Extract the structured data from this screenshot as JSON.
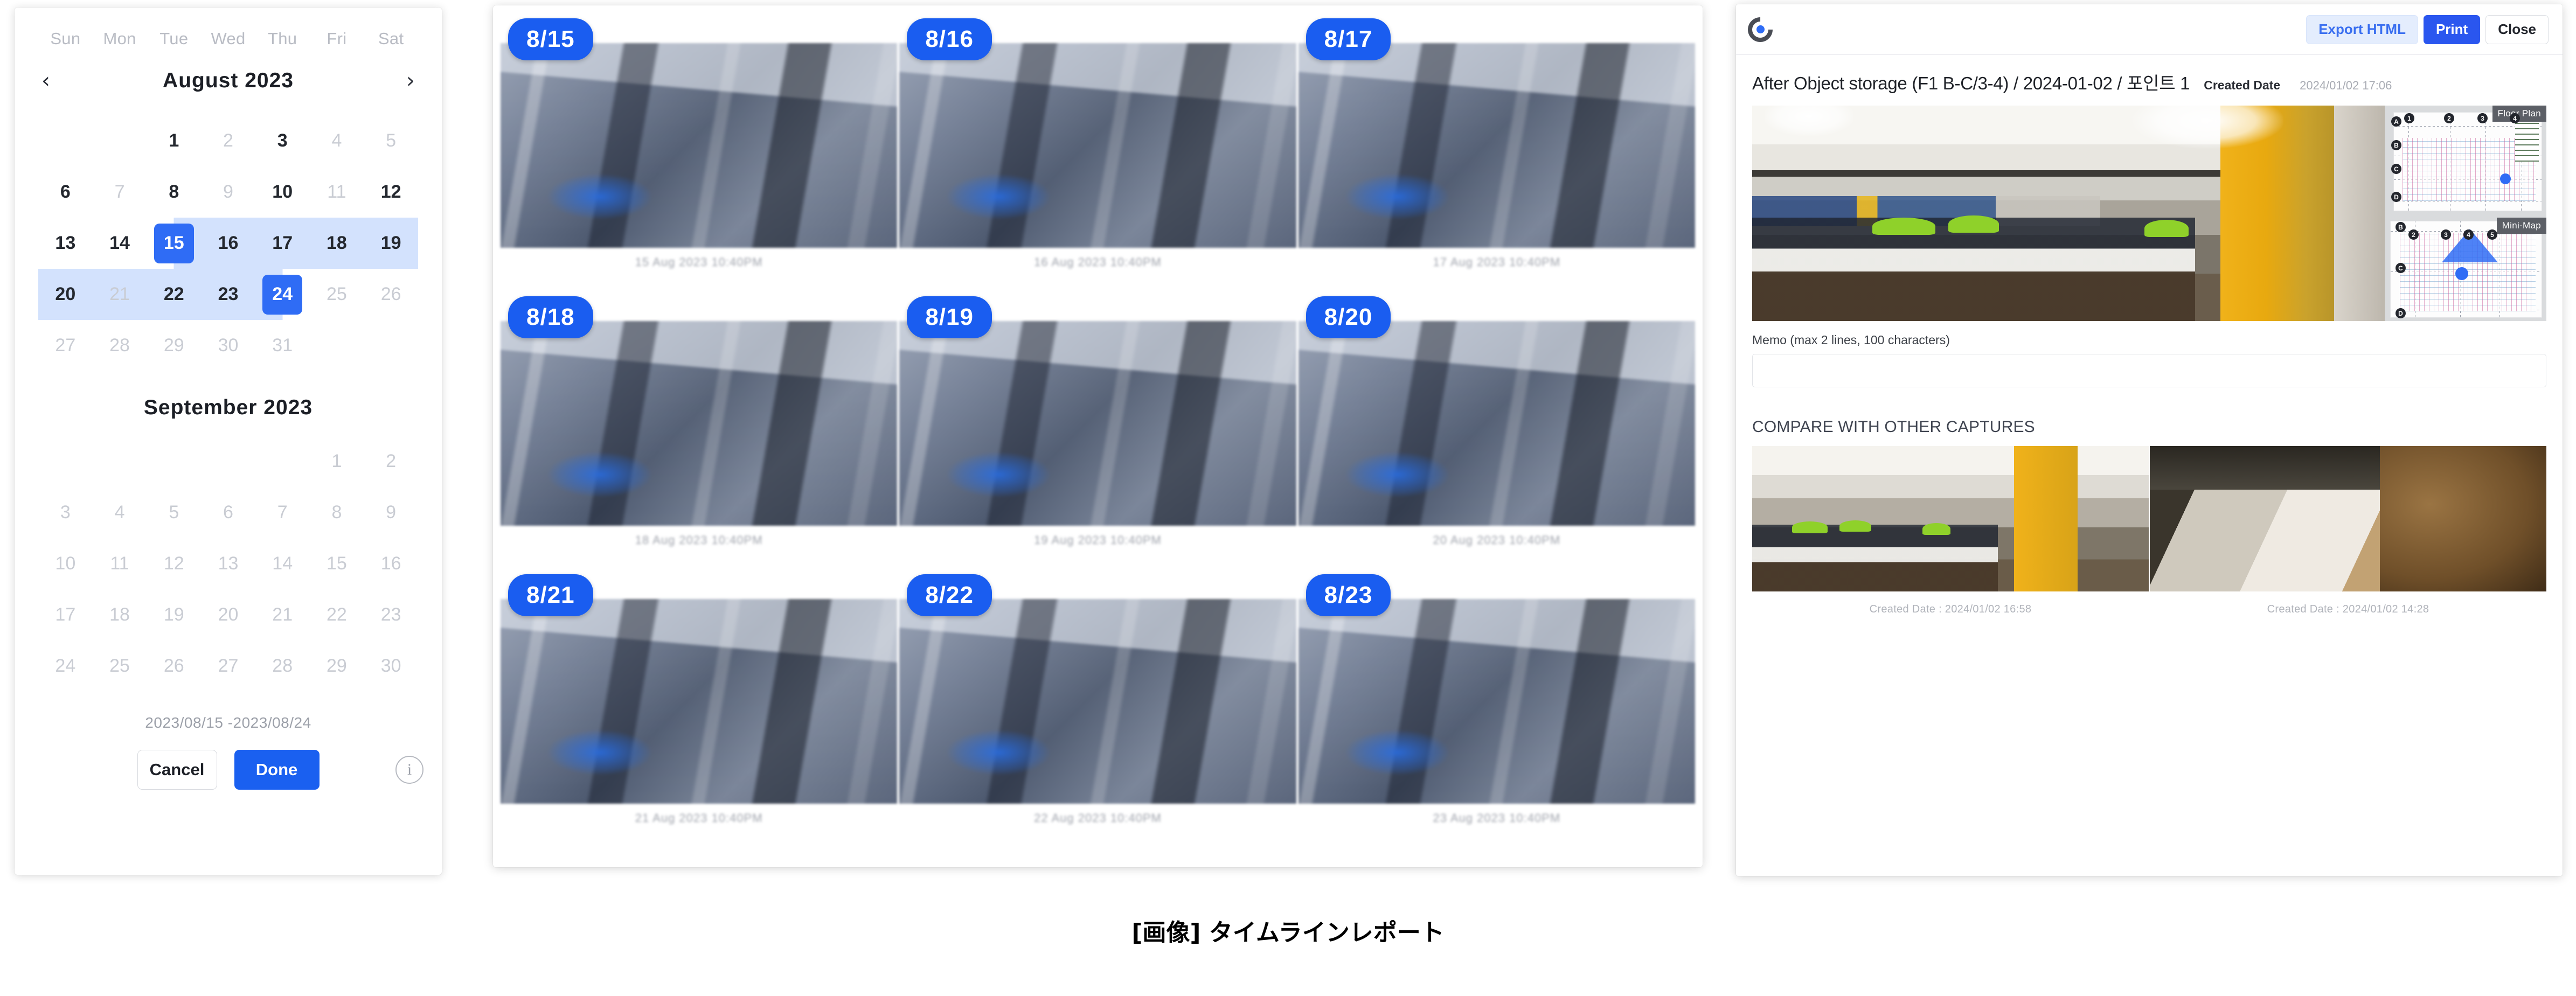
{
  "bottom_caption": "[画像] タイムラインレポート",
  "colors": {
    "accent_blue": "#1a5df0",
    "range_blue": "#d3e2fd",
    "primary_blue": "#2a56ef",
    "export_blue_bg": "#e4edfd",
    "muted_text": "#c9ccd3"
  },
  "calendar": {
    "weekdays": [
      "Sun",
      "Mon",
      "Tue",
      "Wed",
      "Thu",
      "Fri",
      "Sat"
    ],
    "prev_icon": "chevron-left-icon",
    "next_icon": "chevron-right-icon",
    "prev_glyph": "‹",
    "next_glyph": "›",
    "month_1": "August  2023",
    "month_2": "September  2023",
    "august_cells": [
      {
        "d": "",
        "state": "blank"
      },
      {
        "d": "",
        "state": "blank"
      },
      {
        "d": "1",
        "state": "normal"
      },
      {
        "d": "2",
        "state": "muted"
      },
      {
        "d": "3",
        "state": "normal"
      },
      {
        "d": "4",
        "state": "muted"
      },
      {
        "d": "5",
        "state": "muted"
      },
      {
        "d": "6",
        "state": "normal"
      },
      {
        "d": "7",
        "state": "muted"
      },
      {
        "d": "8",
        "state": "normal"
      },
      {
        "d": "9",
        "state": "muted"
      },
      {
        "d": "10",
        "state": "normal"
      },
      {
        "d": "11",
        "state": "muted"
      },
      {
        "d": "12",
        "state": "normal"
      },
      {
        "d": "13",
        "state": "normal"
      },
      {
        "d": "14",
        "state": "normal"
      },
      {
        "d": "15",
        "state": "selected-start"
      },
      {
        "d": "16",
        "state": "in-range"
      },
      {
        "d": "17",
        "state": "in-range"
      },
      {
        "d": "18",
        "state": "in-range"
      },
      {
        "d": "19",
        "state": "in-range"
      },
      {
        "d": "20",
        "state": "in-range"
      },
      {
        "d": "21",
        "state": "in-range-muted"
      },
      {
        "d": "22",
        "state": "in-range"
      },
      {
        "d": "23",
        "state": "in-range"
      },
      {
        "d": "24",
        "state": "selected-end"
      },
      {
        "d": "25",
        "state": "muted"
      },
      {
        "d": "26",
        "state": "muted"
      },
      {
        "d": "27",
        "state": "muted"
      },
      {
        "d": "28",
        "state": "muted"
      },
      {
        "d": "29",
        "state": "muted"
      },
      {
        "d": "30",
        "state": "muted"
      },
      {
        "d": "31",
        "state": "muted"
      },
      {
        "d": "",
        "state": "blank"
      },
      {
        "d": "",
        "state": "blank"
      }
    ],
    "september_cells": [
      {
        "d": "",
        "state": "blank"
      },
      {
        "d": "",
        "state": "blank"
      },
      {
        "d": "",
        "state": "blank"
      },
      {
        "d": "",
        "state": "blank"
      },
      {
        "d": "",
        "state": "blank"
      },
      {
        "d": "1",
        "state": "muted"
      },
      {
        "d": "2",
        "state": "muted"
      },
      {
        "d": "3",
        "state": "muted"
      },
      {
        "d": "4",
        "state": "muted"
      },
      {
        "d": "5",
        "state": "muted"
      },
      {
        "d": "6",
        "state": "muted"
      },
      {
        "d": "7",
        "state": "muted"
      },
      {
        "d": "8",
        "state": "muted"
      },
      {
        "d": "9",
        "state": "muted"
      },
      {
        "d": "10",
        "state": "muted"
      },
      {
        "d": "11",
        "state": "muted"
      },
      {
        "d": "12",
        "state": "muted"
      },
      {
        "d": "13",
        "state": "muted"
      },
      {
        "d": "14",
        "state": "muted"
      },
      {
        "d": "15",
        "state": "muted"
      },
      {
        "d": "16",
        "state": "muted"
      },
      {
        "d": "17",
        "state": "muted"
      },
      {
        "d": "18",
        "state": "muted"
      },
      {
        "d": "19",
        "state": "muted"
      },
      {
        "d": "20",
        "state": "muted"
      },
      {
        "d": "21",
        "state": "muted"
      },
      {
        "d": "22",
        "state": "muted"
      },
      {
        "d": "23",
        "state": "muted"
      },
      {
        "d": "24",
        "state": "muted"
      },
      {
        "d": "25",
        "state": "muted"
      },
      {
        "d": "26",
        "state": "muted"
      },
      {
        "d": "27",
        "state": "muted"
      },
      {
        "d": "28",
        "state": "muted"
      },
      {
        "d": "29",
        "state": "muted"
      },
      {
        "d": "30",
        "state": "muted"
      }
    ],
    "range_label": "2023/08/15 -2023/08/24",
    "cancel_label": "Cancel",
    "done_label": "Done",
    "info_glyph": "i"
  },
  "timeline": {
    "cells": [
      {
        "badge": "8/15",
        "caption": "15 Aug 2023 10:40PM"
      },
      {
        "badge": "8/16",
        "caption": "16 Aug 2023 10:40PM"
      },
      {
        "badge": "8/17",
        "caption": "17 Aug 2023 10:40PM"
      },
      {
        "badge": "8/18",
        "caption": "18 Aug 2023 10:40PM"
      },
      {
        "badge": "8/19",
        "caption": "19 Aug 2023 10:40PM"
      },
      {
        "badge": "8/20",
        "caption": "20 Aug 2023 10:40PM"
      },
      {
        "badge": "8/21",
        "caption": "21 Aug 2023 10:40PM"
      },
      {
        "badge": "8/22",
        "caption": "22 Aug 2023 10:40PM"
      },
      {
        "badge": "8/23",
        "caption": "23 Aug 2023 10:40PM"
      }
    ]
  },
  "report": {
    "logo_name": "app-logo-icon",
    "buttons": {
      "export": "Export HTML",
      "print": "Print",
      "close": "Close"
    },
    "title": "After Object storage (F1 B-C/3-4) / 2024-01-02 / 포인트 1",
    "created_label": "Created Date",
    "created_value": "2024/01/02 17:06",
    "floor_plan_label": "Floor Plan",
    "mini_map_label": "Mini-Map",
    "floor_grid_cols": [
      "1",
      "2",
      "3",
      "4"
    ],
    "floor_grid_rows": [
      "A",
      "B",
      "C",
      "D"
    ],
    "mini_grid_cols": [
      "2",
      "3",
      "4",
      "5"
    ],
    "mini_grid_rows": [
      "B",
      "C",
      "D"
    ],
    "memo_label": "Memo (max 2 lines, 100 characters)",
    "memo_value": "",
    "memo_placeholder": "",
    "compare_title": "COMPARE WITH OTHER CAPTURES",
    "compare": [
      {
        "caption": "Created Date : 2024/01/02 16:58"
      },
      {
        "caption": "Created Date : 2024/01/02 14:28"
      }
    ]
  }
}
